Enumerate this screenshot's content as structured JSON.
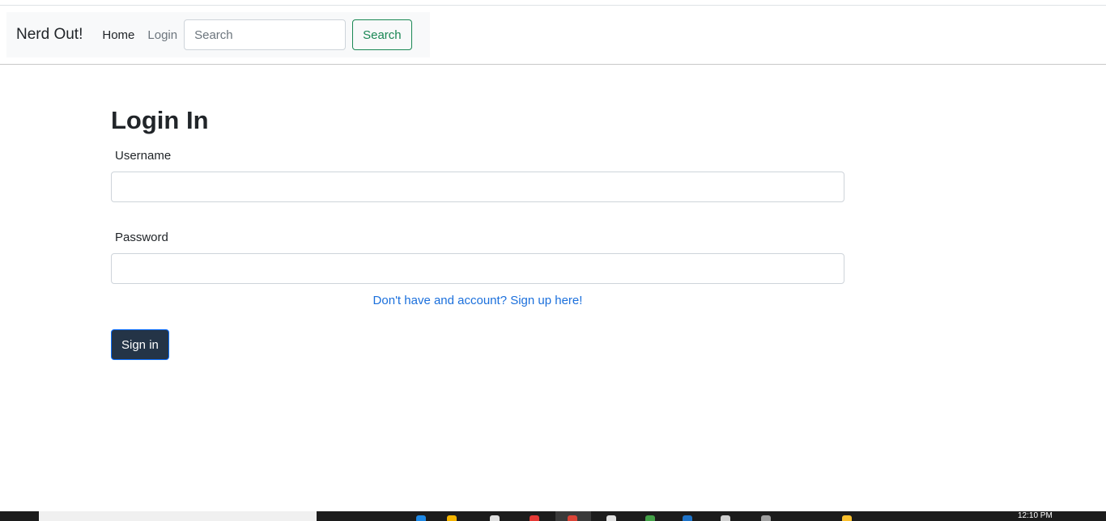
{
  "navbar": {
    "brand": "Nerd Out!",
    "links": [
      {
        "label": "Home"
      },
      {
        "label": "Login"
      }
    ],
    "search": {
      "placeholder": "Search",
      "value": "",
      "button_label": "Search"
    }
  },
  "main": {
    "title": "Login In",
    "username": {
      "label": "Username",
      "value": ""
    },
    "password": {
      "label": "Password",
      "value": ""
    },
    "signup_link": "Don't have and account? Sign up here!",
    "submit_label": "Sign in"
  },
  "taskbar": {
    "clock": "12:10 PM",
    "icons": [
      {
        "name": "edge-browser-icon",
        "color": "#1e88e5"
      },
      {
        "name": "folder-icon",
        "color": "#f4b400"
      },
      {
        "name": "store-icon",
        "color": "#e0e0e0"
      },
      {
        "name": "pen-app-icon",
        "color": "#e53935"
      },
      {
        "name": "chrome-icon",
        "color": "#db4437"
      },
      {
        "name": "github-icon",
        "color": "#e0e0e0"
      },
      {
        "name": "green-app-icon",
        "color": "#43a047"
      },
      {
        "name": "vscode-icon",
        "color": "#1e73c8"
      },
      {
        "name": "terminal-icon",
        "color": "#cfcfcf"
      },
      {
        "name": "misc-app-icon",
        "color": "#9e9e9e"
      },
      {
        "name": "sticky-notes-icon",
        "color": "#fbc02d"
      }
    ]
  },
  "colors": {
    "nav_background": "#f8f9fa",
    "search_button": "#198754",
    "link": "#1a6fdc",
    "submit_background": "#243447",
    "submit_border": "#0d6efd"
  }
}
